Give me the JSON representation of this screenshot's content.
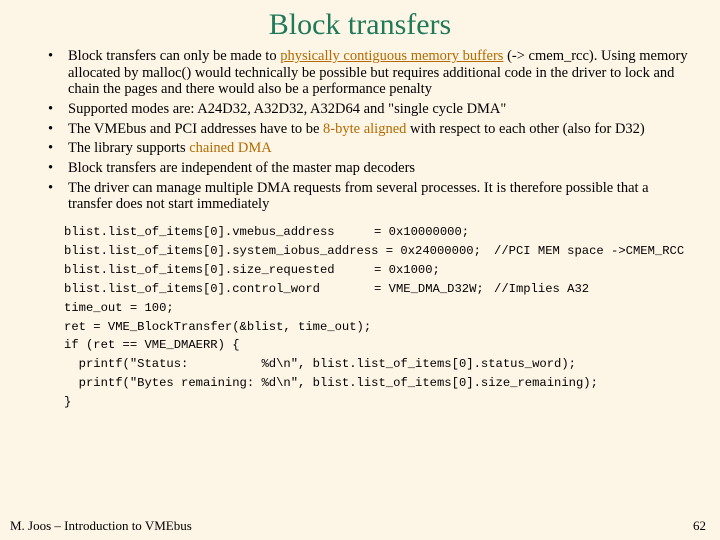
{
  "title": "Block transfers",
  "bullets": {
    "b1": {
      "pre": "Block transfers can only be made to ",
      "hl": "physically contiguous memory buffers",
      "post": " (-> cmem_rcc). Using memory allocated by malloc() would technically be possible but requires additional code in the driver to lock and chain the pages and there would also be a performance penalty"
    },
    "b2": "Supported modes are: A24D32, A32D32, A32D64 and \"single cycle DMA\"",
    "b3": {
      "pre": "The VMEbus and PCI addresses have to be ",
      "hl": "8-byte aligned",
      "post": " with respect to each other (also for D32)"
    },
    "b4": {
      "pre": "The library supports ",
      "hl": "chained DMA"
    },
    "b5": "Block transfers are independent of the master map decoders",
    "b6": "The driver can manage multiple DMA requests from several processes. It is therefore possible that a transfer does not start immediately"
  },
  "code": {
    "l1a": "blist.list_of_items[0].vmebus_address",
    "l1b": "= 0x10000000;",
    "l2a": "blist.list_of_items[0].system_iobus_address = 0x24000000;",
    "l2b": "//PCI MEM space ->CMEM_RCC",
    "l3a": "blist.list_of_items[0].size_requested",
    "l3b": "= 0x1000;",
    "l4a": "blist.list_of_items[0].control_word",
    "l4b": "= VME_DMA_D32W;",
    "l4c": "//Implies A32",
    "l5": "time_out = 100;",
    "l6": "ret = VME_BlockTransfer(&blist, time_out);",
    "l7": "if (ret == VME_DMAERR) {",
    "l8": "  printf(\"Status:          %d\\n\", blist.list_of_items[0].status_word);",
    "l9": "  printf(\"Bytes remaining: %d\\n\", blist.list_of_items[0].size_remaining);",
    "l10": "}"
  },
  "footer": "M. Joos – Introduction to VMEbus",
  "pagenum": "62"
}
